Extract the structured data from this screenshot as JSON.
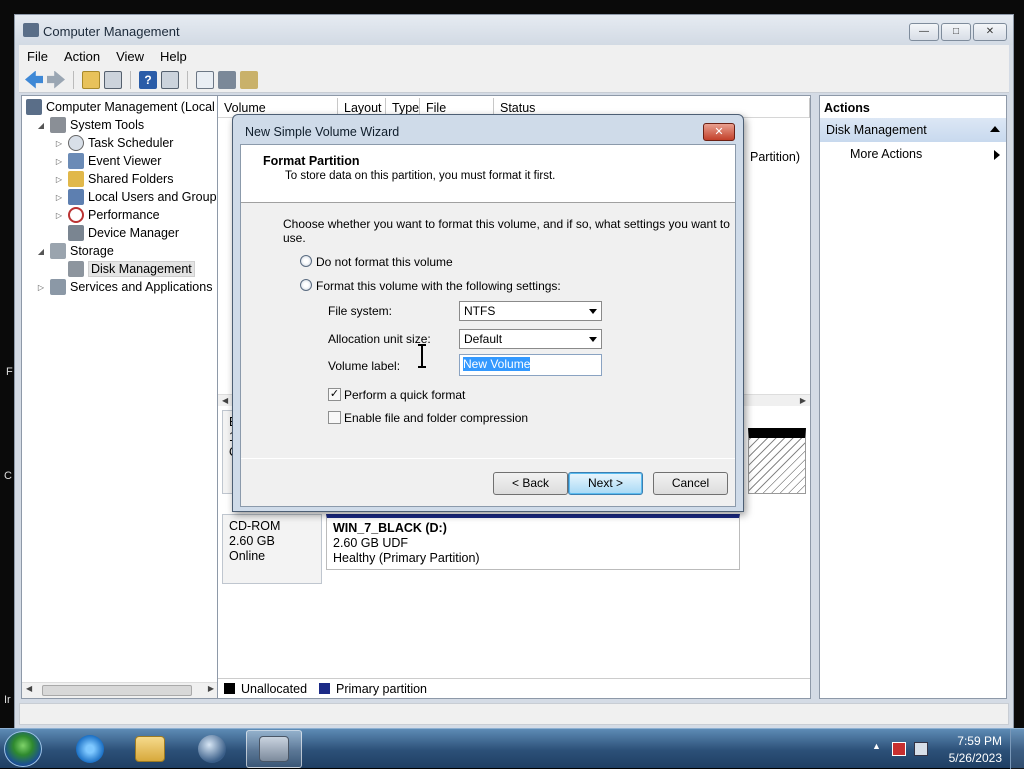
{
  "window": {
    "title": "Computer Management",
    "buttons": {
      "minimize": "—",
      "maximize": "□",
      "close": "✕"
    }
  },
  "menubar": [
    "File",
    "Action",
    "View",
    "Help"
  ],
  "tree": {
    "root": "Computer Management (Local",
    "items": [
      {
        "label": "System Tools"
      },
      {
        "label": "Task Scheduler"
      },
      {
        "label": "Event Viewer"
      },
      {
        "label": "Shared Folders"
      },
      {
        "label": "Local Users and Groups"
      },
      {
        "label": "Performance"
      },
      {
        "label": "Device Manager"
      },
      {
        "label": "Storage"
      },
      {
        "label": "Disk Management"
      },
      {
        "label": "Services and Applications"
      }
    ]
  },
  "volume_list": {
    "columns": [
      "Volume",
      "Layout",
      "Type",
      "File System",
      "Status"
    ],
    "partial_status": "Partition)"
  },
  "disks": {
    "disk0": {
      "line1": "B",
      "line2": "1(",
      "line3": "O"
    },
    "cdrom": {
      "name": "CD-ROM",
      "size": "2.60 GB",
      "state": "Online",
      "volume_name": "WIN_7_BLACK  (D:)",
      "volume_size": "2.60 GB UDF",
      "volume_status": "Healthy (Primary Partition)"
    }
  },
  "legend": {
    "unallocated": "Unallocated",
    "primary": "Primary partition",
    "unallocated_color": "#000000",
    "primary_color": "#1b2a86"
  },
  "actions": {
    "header": "Actions",
    "section": "Disk Management",
    "more": "More Actions"
  },
  "dialog": {
    "title": "New Simple Volume Wizard",
    "header_title": "Format Partition",
    "header_subtitle": "To store data on this partition, you must format it first.",
    "intro": "Choose whether you want to format this volume, and if so, what settings you want to use.",
    "radio_no_format": "Do not format this volume",
    "radio_format": "Format this volume with the following settings:",
    "file_system_label": "File system:",
    "file_system_value": "NTFS",
    "alloc_label": "Allocation unit size:",
    "alloc_value": "Default",
    "volume_label_label": "Volume label:",
    "volume_label_value": "New Volume",
    "quick_format": "Perform a quick format",
    "compression": "Enable file and folder compression",
    "back": "< Back",
    "next": "Next >",
    "cancel": "Cancel"
  },
  "taskbar": {
    "time": "7:59 PM",
    "date": "5/26/2023"
  },
  "desktop_chars": [
    "F",
    "C",
    "Ir"
  ]
}
